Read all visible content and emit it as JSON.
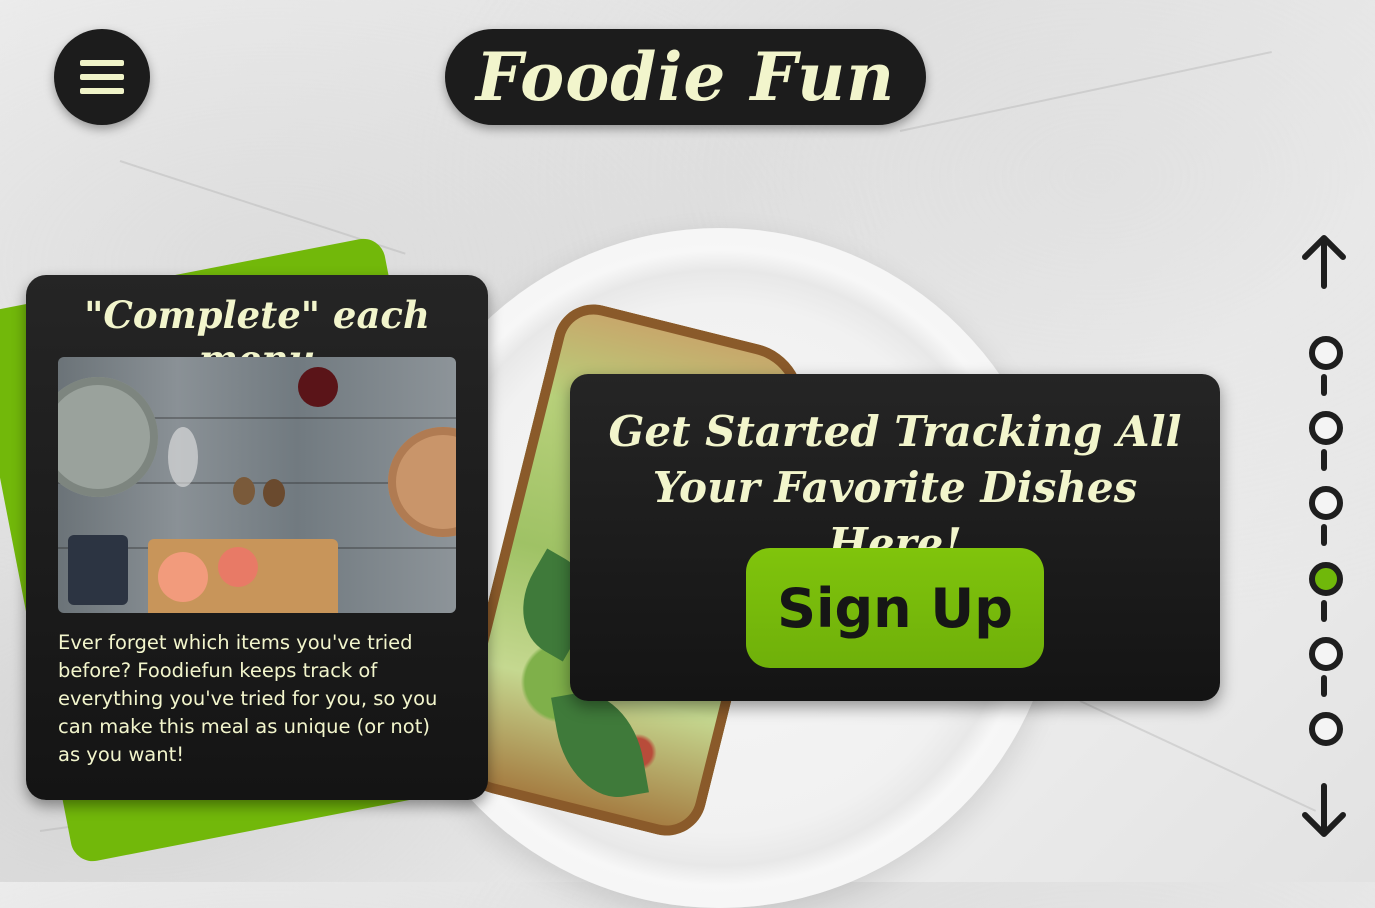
{
  "header": {
    "menu_icon": "hamburger-menu-icon",
    "brand_title": "Foodie Fun"
  },
  "feature_card": {
    "title": "\"Complete\" each menu",
    "body": "Ever forget which items you've tried before? Foodiefun keeps track of everything you've tried for you, so you can make this meal as unique (or not) as you want!"
  },
  "cta_card": {
    "heading": "Get Started Tracking All Your Favorite Dishes Here!",
    "button_label": "Sign Up"
  },
  "pager": {
    "up_icon": "arrow-up-icon",
    "down_icon": "arrow-down-icon",
    "total_slides": 6,
    "active_index": 3
  },
  "colors": {
    "accent_green": "#72b80a",
    "card_dark": "#1c1c1c",
    "cream_text": "#f2f5cc"
  }
}
